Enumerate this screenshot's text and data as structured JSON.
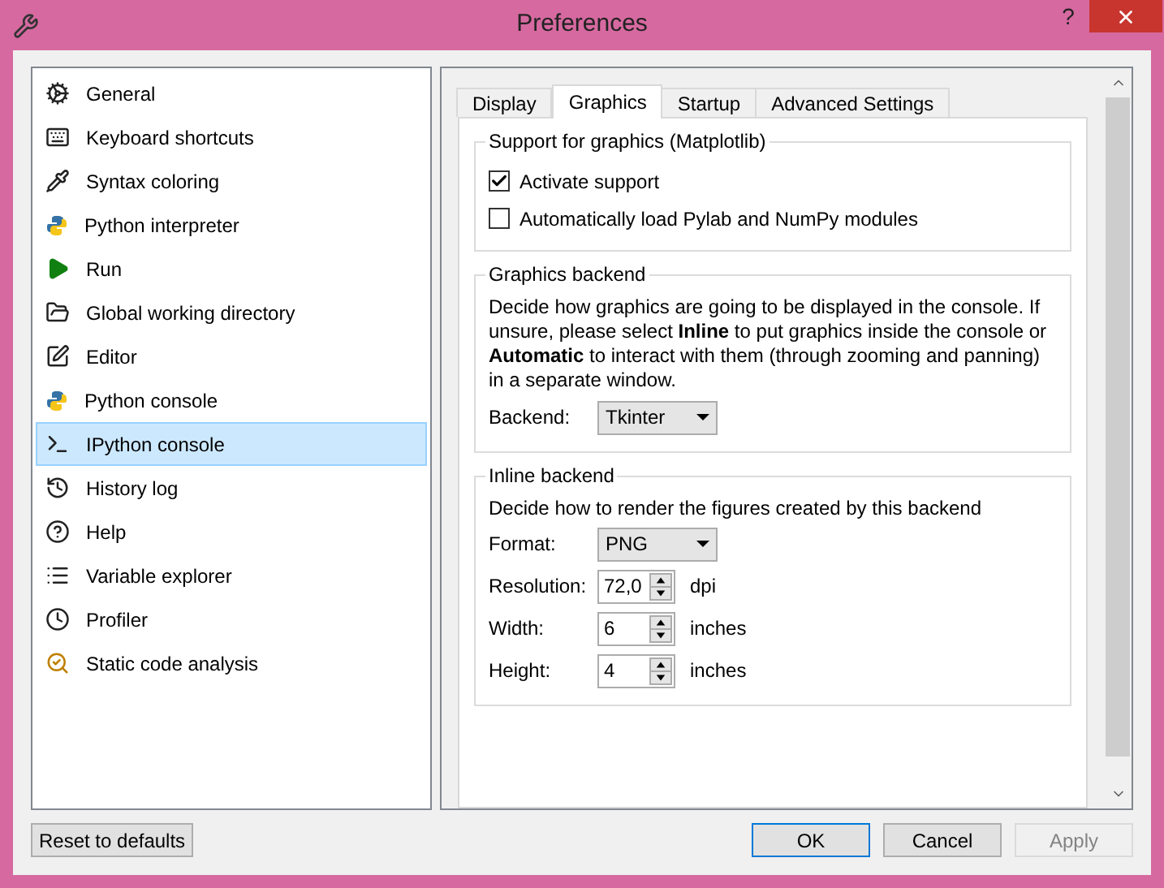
{
  "window": {
    "title": "Preferences",
    "help_button": "?"
  },
  "sidebar": {
    "items": [
      {
        "label": "General",
        "selected": false
      },
      {
        "label": "Keyboard shortcuts",
        "selected": false
      },
      {
        "label": "Syntax coloring",
        "selected": false
      },
      {
        "label": "Python interpreter",
        "selected": false
      },
      {
        "label": "Run",
        "selected": false
      },
      {
        "label": "Global working directory",
        "selected": false
      },
      {
        "label": "Editor",
        "selected": false
      },
      {
        "label": "Python console",
        "selected": false
      },
      {
        "label": "IPython console",
        "selected": true
      },
      {
        "label": "History log",
        "selected": false
      },
      {
        "label": "Help",
        "selected": false
      },
      {
        "label": "Variable explorer",
        "selected": false
      },
      {
        "label": "Profiler",
        "selected": false
      },
      {
        "label": "Static code analysis",
        "selected": false
      }
    ]
  },
  "tabs": [
    {
      "label": "Display",
      "selected": false
    },
    {
      "label": "Graphics",
      "selected": true
    },
    {
      "label": "Startup",
      "selected": false
    },
    {
      "label": "Advanced Settings",
      "selected": false
    }
  ],
  "support_group": {
    "title": "Support for graphics (Matplotlib)",
    "checkboxes": [
      {
        "label": "Activate support",
        "checked": true
      },
      {
        "label": "Automatically load Pylab and NumPy modules",
        "checked": false
      }
    ]
  },
  "backend_group": {
    "title": "Graphics backend",
    "description": "Decide how graphics are going to be displayed in the console. If unsure, please select **Inline** to put graphics inside the console or **Automatic** to interact with them (through zooming and panning) in a separate window.",
    "fields": [
      {
        "kind": "combo",
        "label": "Backend:",
        "value": "Tkinter"
      }
    ]
  },
  "inline_group": {
    "title": "Inline backend",
    "description": "Decide how to render the figures created by this backend",
    "fields": [
      {
        "kind": "combo",
        "label": "Format:",
        "value": "PNG"
      },
      {
        "kind": "spin",
        "label": "Resolution:",
        "value": "72,0",
        "unit": "dpi"
      },
      {
        "kind": "spin",
        "label": "Width:",
        "value": "6",
        "unit": "inches"
      },
      {
        "kind": "spin",
        "label": "Height:",
        "value": "4",
        "unit": "inches"
      }
    ]
  },
  "buttons": {
    "reset": {
      "label": "Reset to defaults",
      "disabled": false
    },
    "actions": [
      {
        "label": "OK",
        "default": true,
        "disabled": false
      },
      {
        "label": "Cancel",
        "default": false,
        "disabled": false
      },
      {
        "label": "Apply",
        "default": false,
        "disabled": true
      }
    ]
  }
}
